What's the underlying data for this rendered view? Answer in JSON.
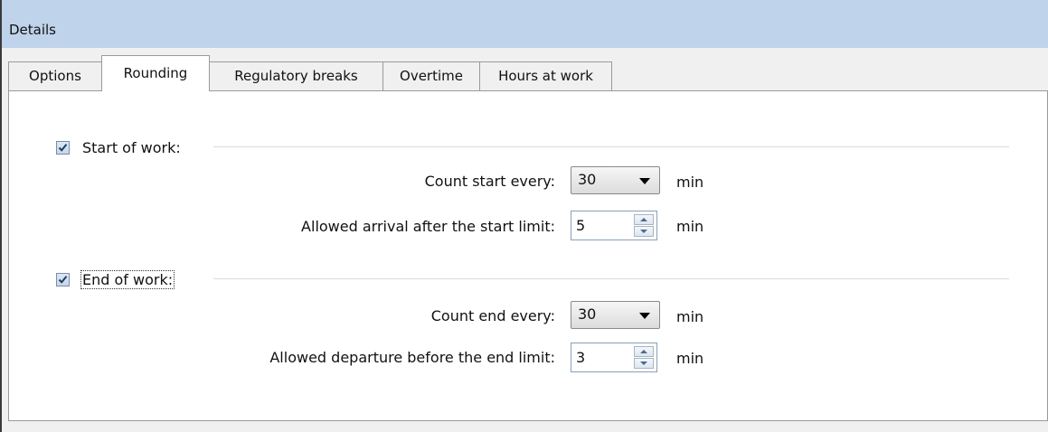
{
  "header": {
    "title": "Details"
  },
  "tabs": [
    {
      "label": "Options",
      "active": false
    },
    {
      "label": "Rounding",
      "active": true
    },
    {
      "label": "Regulatory breaks",
      "active": false
    },
    {
      "label": "Overtime",
      "active": false
    },
    {
      "label": "Hours at work",
      "active": false
    }
  ],
  "start_group": {
    "checked": true,
    "label": "Start of work:",
    "count_label": "Count start every:",
    "count_value": "30",
    "count_unit": "min",
    "allowed_label": "Allowed arrival after the start limit:",
    "allowed_value": "5",
    "allowed_unit": "min"
  },
  "end_group": {
    "checked": true,
    "label": "End of work:",
    "count_label": "Count end every:",
    "count_value": "30",
    "count_unit": "min",
    "allowed_label": "Allowed departure before the end limit:",
    "allowed_value": "3",
    "allowed_unit": "min"
  },
  "colors": {
    "header_bg": "#bfd3ea",
    "panel_bg": "#ffffff",
    "window_bg": "#f0f0f0"
  },
  "icons": {
    "checkbox_check": "checkmark-icon",
    "dropdown": "chevron-down-icon",
    "spin_up": "arrow-up-icon",
    "spin_down": "arrow-down-icon"
  }
}
